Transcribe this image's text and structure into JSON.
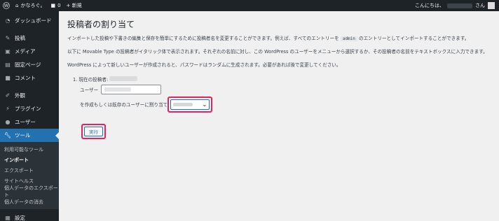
{
  "adminbar": {
    "site_name": "かなろぐ。",
    "comments_count": "0",
    "new_label": "+ 新規",
    "greeting": "こんにちは、",
    "greeting_suffix": "さん"
  },
  "sidebar": {
    "dashboard": "ダッシュボード",
    "posts": "投稿",
    "media": "メディア",
    "pages": "固定ページ",
    "comments": "コメント",
    "appearance": "外観",
    "plugins": "プラグイン",
    "users": "ユーザー",
    "tools": "ツール",
    "sub_available_tools": "利用可能なツール",
    "sub_import": "インポート",
    "sub_export": "エクスポート",
    "sub_site_health": "サイトヘルス",
    "sub_export_personal": "個人データのエクスポート",
    "sub_erase_personal": "個人データの消去",
    "settings": "設定"
  },
  "main": {
    "title": "投稿者の割り当て",
    "para1_a": "インポートした投稿や下書きの編集と保存を簡単にするために投稿者名を変更することができます。例えば、すべてのエントリーを",
    "para1_code": "admin",
    "para1_b": "のエントリーとしてインポートすることができます。",
    "para2": "以下に Movable Type の投稿者がイタリック体で表示されます。それぞれの名前に対し、この WordPress のユーザーをメニューから選択するか、その投稿者の名前をテキストボックスに入力できます。",
    "para3": "WordPress によって新しいユーザーが作成されると、パスワードはランダムに生成されます。必要があれば後で変更してください。",
    "item_label": "1. 現在の投稿者:",
    "user_label": "ユーザー",
    "assign_label": "を作成もしくは既存のユーザーに割り当て",
    "submit_label": "実行"
  },
  "colors": {
    "admin_dark": "#1d2327",
    "accent_blue": "#2271b1",
    "highlight_pink": "#e0245e",
    "background": "#f0f0f1"
  }
}
